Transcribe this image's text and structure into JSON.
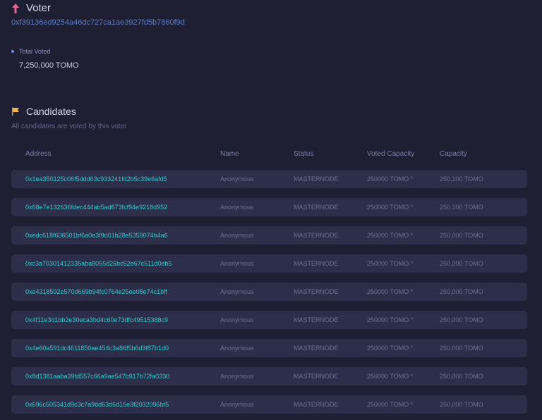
{
  "voter": {
    "title": "Voter",
    "address": "0xf39136ed9254a46dc727ca1ae3927fd5b7860f9d",
    "arrow_color": "#e5668f"
  },
  "total": {
    "label": "Total Voted",
    "value": "7,250,000 TOMO"
  },
  "candidates": {
    "title": "Candidates",
    "subtitle": "All candidates are voted by this voter",
    "flag_color": "#f2b84b",
    "columns": {
      "address": "Address",
      "name": "Name",
      "status": "Status",
      "voted_capacity": "Voted Capacity",
      "capacity": "Capacity"
    },
    "rows": [
      {
        "address": "0x1ea350125c06f5ddd63c933241fd2b5c39e6afd5",
        "name": "Anonymous",
        "status": "MASTERNODE",
        "voted": "250000 TOMO *",
        "capacity": "250,100 TOMO"
      },
      {
        "address": "0x68e7e132636fdec444ab5ad673fcf94e9218d952",
        "name": "Anonymous",
        "status": "MASTERNODE",
        "voted": "250000 TOMO *",
        "capacity": "250,100 TOMO"
      },
      {
        "address": "0xedc618f606501bf6a0e3f9d01b28e5359074b4a6",
        "name": "Anonymous",
        "status": "MASTERNODE",
        "voted": "250000 TOMO *",
        "capacity": "250,000 TOMO"
      },
      {
        "address": "0xc3a70301412335aba8055d26bc62e67c511d0eb5",
        "name": "Anonymous",
        "status": "MASTERNODE",
        "voted": "250000 TOMO *",
        "capacity": "250,000 TOMO"
      },
      {
        "address": "0xe4318592e570d669b94fc0764e25ee08e74c1bff",
        "name": "Anonymous",
        "status": "MASTERNODE",
        "voted": "250000 TOMO *",
        "capacity": "250,000 TOMO"
      },
      {
        "address": "0x4f11e3d1bb2e30eca3bd4c60e73dfc49515388c9",
        "name": "Anonymous",
        "status": "MASTERNODE",
        "voted": "250000 TOMO *",
        "capacity": "250,000 TOMO"
      },
      {
        "address": "0x4e60a591dc4611850ae454c3a86f5b6d3f87b1d0",
        "name": "Anonymous",
        "status": "MASTERNODE",
        "voted": "250000 TOMO *",
        "capacity": "250,000 TOMO"
      },
      {
        "address": "0x8d1381aaba39fd557c66a9ae547b917b72fa0330",
        "name": "Anonymous",
        "status": "MASTERNODE",
        "voted": "250000 TOMO *",
        "capacity": "250,000 TOMO"
      },
      {
        "address": "0x696c505341d9c3c7a9dd63d6d15e3f2032096bf5",
        "name": "Anonymous",
        "status": "MASTERNODE",
        "voted": "250000 TOMO *",
        "capacity": "250,000 TOMO"
      }
    ]
  }
}
